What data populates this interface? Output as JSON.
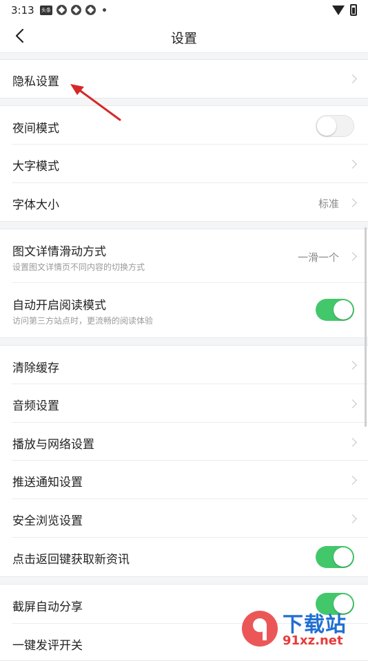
{
  "status": {
    "time": "3:13",
    "badge": "头条"
  },
  "nav": {
    "title": "设置"
  },
  "groups": [
    {
      "items": [
        {
          "label": "隐私设置"
        }
      ]
    },
    {
      "items": [
        {
          "label": "夜间模式",
          "toggle": "off"
        },
        {
          "label": "大字模式"
        },
        {
          "label": "字体大小",
          "value": "标准"
        }
      ]
    },
    {
      "items": [
        {
          "label": "图文详情滑动方式",
          "sub": "设置图文详情页不同内容的切换方式",
          "value": "一滑一个"
        },
        {
          "label": "自动开启阅读模式",
          "sub": "访问第三方站点时，更流畅的阅读体验",
          "toggle": "on"
        }
      ]
    },
    {
      "items": [
        {
          "label": "清除缓存"
        },
        {
          "label": "音频设置"
        },
        {
          "label": "播放与网络设置"
        },
        {
          "label": "推送通知设置"
        },
        {
          "label": "安全浏览设置"
        },
        {
          "label": "点击返回键获取新资讯",
          "toggle": "on"
        }
      ]
    },
    {
      "items": [
        {
          "label": "截屏自动分享",
          "toggle": "on"
        },
        {
          "label": "一键发评开关"
        }
      ]
    }
  ],
  "watermark": {
    "text": "下载站",
    "url": "91xz.net"
  },
  "colors": {
    "toggle_on": "#43c76b",
    "annotation": "#d62828"
  }
}
